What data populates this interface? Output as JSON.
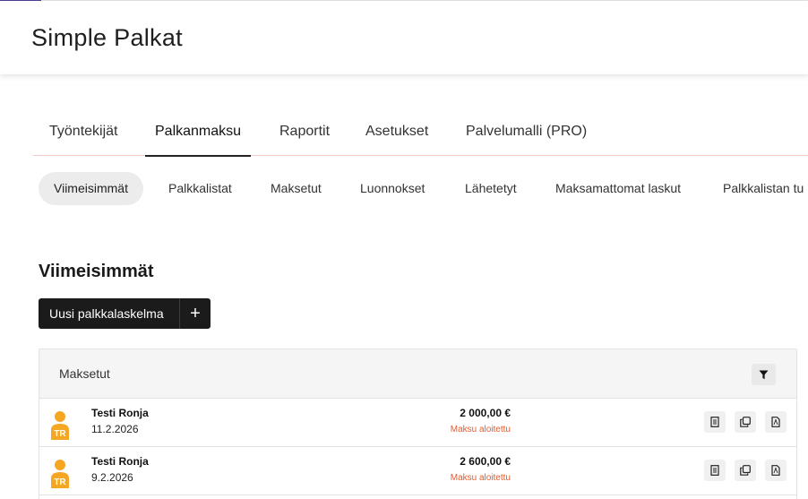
{
  "app": {
    "title": "Simple Palkat"
  },
  "main_tabs": [
    {
      "label": "Työntekijät"
    },
    {
      "label": "Palkanmaksu",
      "active": true
    },
    {
      "label": "Raportit"
    },
    {
      "label": "Asetukset"
    },
    {
      "label": "Palvelumalli (PRO)"
    }
  ],
  "sub_tabs": [
    {
      "label": "Viimeisimmät",
      "active": true
    },
    {
      "label": "Palkkalistat"
    },
    {
      "label": "Maksetut"
    },
    {
      "label": "Luonnokset"
    },
    {
      "label": "Lähetetyt"
    },
    {
      "label": "Maksamattomat laskut"
    },
    {
      "label": "Palkkalistan tu"
    }
  ],
  "section": {
    "title": "Viimeisimmät"
  },
  "new_button": {
    "label": "Uusi palkkalaskelma",
    "plus": "+"
  },
  "panel": {
    "title": "Maksetut"
  },
  "rows": [
    {
      "name": "Testi Ronja",
      "date": "11.2.2026",
      "amount": "2 000,00 €",
      "status": "Maksu aloitettu",
      "avatar_initials": "TR"
    },
    {
      "name": "Testi Ronja",
      "date": "9.2.2026",
      "amount": "2 600,00 €",
      "status": "Maksu aloitettu",
      "avatar_initials": "TR"
    }
  ],
  "colors": {
    "accent": "#4a3f8f",
    "avatar": "#f5a623",
    "status": "#e8592a",
    "button": "#1b1b1b"
  },
  "icons": {
    "filter": "filter-icon",
    "document": "document-icon",
    "copy": "copy-icon",
    "pdf": "pdf-icon"
  }
}
